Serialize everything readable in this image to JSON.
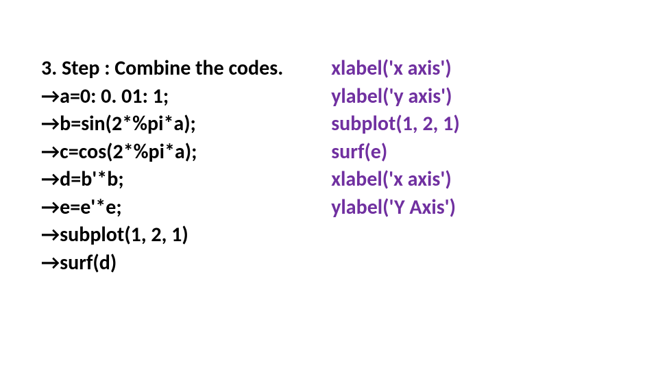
{
  "left": {
    "heading": "3. Step : Combine the codes.",
    "lines": [
      "→a=0: 0. 01: 1;",
      "→b=sin(2*%pi*a);",
      "→c=cos(2*%pi*a);",
      "→d=b'*b;",
      "→e=e'*e;",
      "→subplot(1, 2, 1)",
      "→surf(d)"
    ]
  },
  "right": {
    "lines": [
      "xlabel('x axis')",
      "ylabel('y axis')",
      "subplot(1, 2, 1)",
      "surf(e)",
      "xlabel('x axis')",
      "ylabel('Y Axis')"
    ]
  }
}
